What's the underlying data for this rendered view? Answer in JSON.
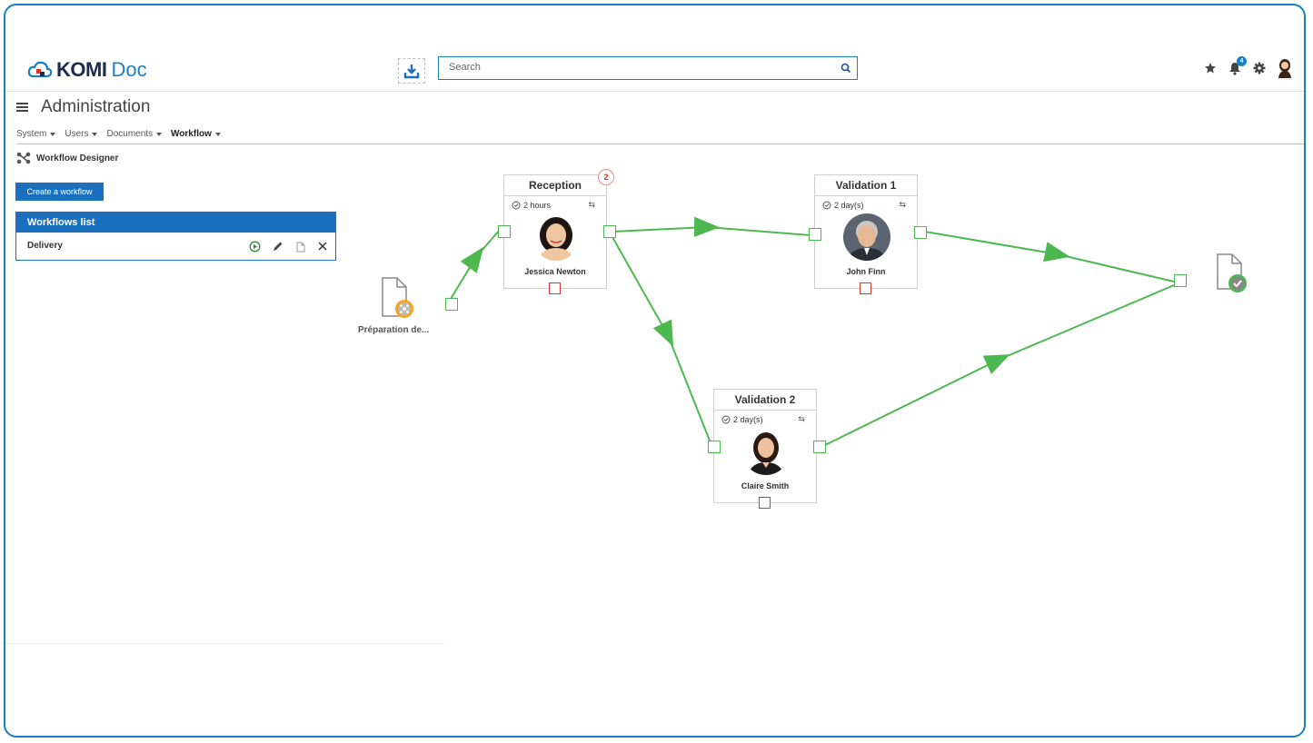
{
  "app": {
    "brand_main": "KOMI",
    "brand_sub": "Doc"
  },
  "search": {
    "placeholder": "Search"
  },
  "header": {
    "notification_count": "4"
  },
  "page": {
    "title": "Administration"
  },
  "menu": {
    "items": [
      "System",
      "Users",
      "Documents",
      "Workflow"
    ]
  },
  "section": {
    "title": "Workflow Designer"
  },
  "create_button": "Create a workflow",
  "workflows": {
    "title": "Workflows list",
    "items": [
      {
        "name": "Delivery"
      }
    ]
  },
  "designer": {
    "start": {
      "label": "Préparation de..."
    },
    "nodes": [
      {
        "title": "Reception",
        "duration": "2 hours",
        "person": "Jessica Newton",
        "badge": "2"
      },
      {
        "title": "Validation 1",
        "duration": "2 day(s)",
        "person": "John Finn"
      },
      {
        "title": "Validation 2",
        "duration": "2 day(s)",
        "person": "Claire Smith"
      }
    ]
  },
  "colors": {
    "accent": "#1a6fbf",
    "edge": "#4db850",
    "error_port": "#e0332d"
  }
}
